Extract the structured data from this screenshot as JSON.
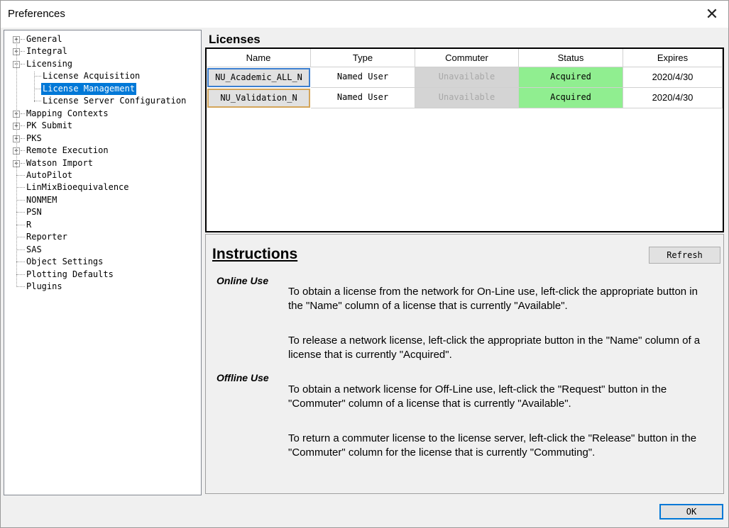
{
  "window": {
    "title": "Preferences",
    "close_glyph": "✕"
  },
  "tree": {
    "items": [
      {
        "label": "General",
        "toggle": "+"
      },
      {
        "label": "Integral",
        "toggle": "+"
      },
      {
        "label": "Licensing",
        "toggle": "−"
      },
      {
        "label": "License Acquisition"
      },
      {
        "label": "License Management",
        "selected": true
      },
      {
        "label": "License Server Configuration"
      },
      {
        "label": "Mapping Contexts",
        "toggle": "+"
      },
      {
        "label": "PK Submit",
        "toggle": "+"
      },
      {
        "label": "PKS",
        "toggle": "+"
      },
      {
        "label": "Remote Execution",
        "toggle": "+"
      },
      {
        "label": "Watson Import",
        "toggle": "+"
      },
      {
        "label": "AutoPilot"
      },
      {
        "label": "LinMixBioequivalence"
      },
      {
        "label": "NONMEM"
      },
      {
        "label": "PSN"
      },
      {
        "label": "R"
      },
      {
        "label": "Reporter"
      },
      {
        "label": "SAS"
      },
      {
        "label": "Object Settings"
      },
      {
        "label": "Plotting Defaults"
      },
      {
        "label": "Plugins"
      }
    ]
  },
  "licenses": {
    "title": "Licenses",
    "columns": [
      "Name",
      "Type",
      "Commuter",
      "Status",
      "Expires"
    ],
    "rows": [
      {
        "name": "NU_Academic_ALL_N",
        "type": "Named User",
        "commuter": "Unavailable",
        "status": "Acquired",
        "expires": "2020/4/30"
      },
      {
        "name": "NU_Validation_N",
        "type": "Named User",
        "commuter": "Unavailable",
        "status": "Acquired",
        "expires": "2020/4/30"
      }
    ]
  },
  "instructions": {
    "title": "Instructions",
    "refresh_label": "Refresh",
    "online_heading": "Online Use",
    "online_p1": "To obtain a license from the network for On-Line use, left-click the appropriate button in the \"Name\" column of a license that is currently \"Available\".",
    "online_p2": "To release a network license, left-click the appropriate button in the \"Name\" column of a license that is currently \"Acquired\".",
    "offline_heading": "Offline Use",
    "offline_p1": "To obtain a network license for Off-Line use, left-click the \"Request\" button in the \"Commuter\" column of a license that is currently \"Available\".",
    "offline_p2": "To return a commuter license to the license server, left-click the \"Release\" button in the \"Commuter\" column for the license that is currently \"Commuting\"."
  },
  "footer": {
    "ok_label": "OK"
  },
  "colors": {
    "selected": "#0078d7",
    "acquired": "#90ee90",
    "unavailable": "#d4d4d4"
  }
}
